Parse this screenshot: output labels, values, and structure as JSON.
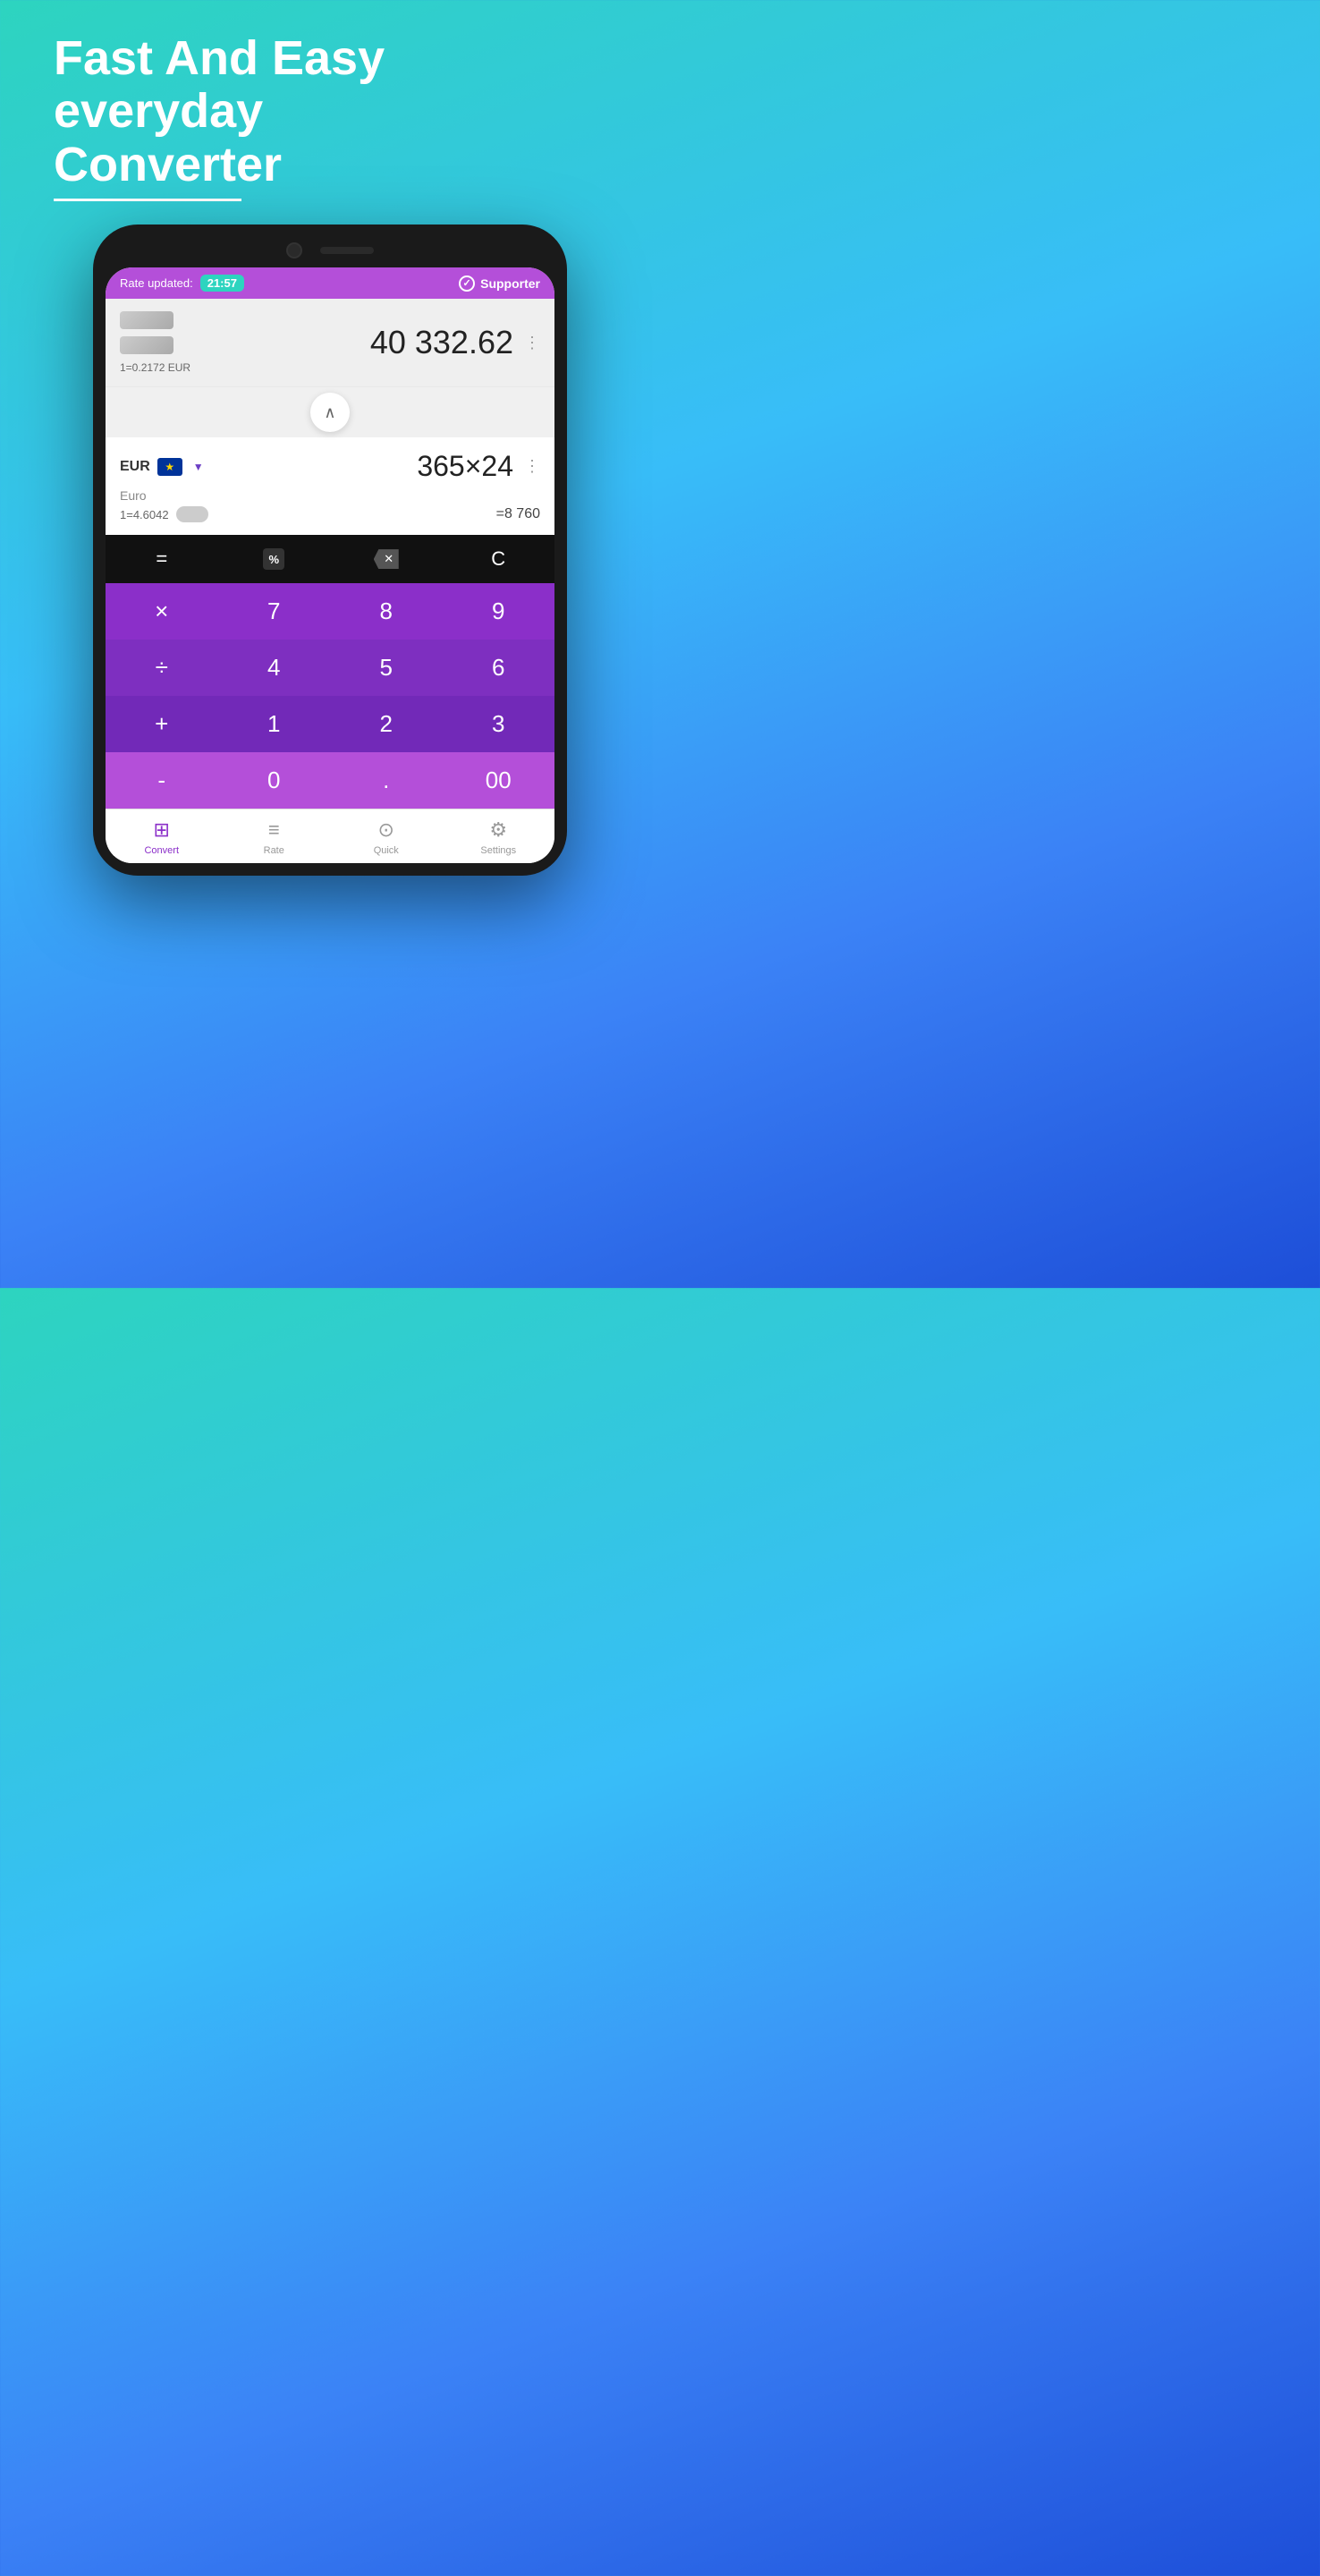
{
  "hero": {
    "line1": "Fast And Easy",
    "line2": "everyday",
    "line3": "Converter"
  },
  "statusBar": {
    "rateLabel": "Rate updated:",
    "time": "21:57",
    "supporterLabel": "Supporter"
  },
  "topCurrency": {
    "value": "40 332.62",
    "rate": "1=0.2172 EUR"
  },
  "bottomCurrency": {
    "expression": "365×24",
    "result": "=8 760",
    "code": "EUR",
    "name": "Euro",
    "rate": "1=4.6042"
  },
  "operators": {
    "equals": "=",
    "percent": "%",
    "backspace": "⌫",
    "clear": "C"
  },
  "numpad": {
    "row1": [
      "×",
      "7",
      "8",
      "9"
    ],
    "row2": [
      "÷",
      "4",
      "5",
      "6"
    ],
    "row3": [
      "+",
      "1",
      "2",
      "3"
    ],
    "row4": [
      "-",
      "0",
      ".",
      "00"
    ]
  },
  "nav": {
    "items": [
      {
        "label": "Convert",
        "active": true
      },
      {
        "label": "Rate",
        "active": false
      },
      {
        "label": "Quick",
        "active": false
      },
      {
        "label": "Settings",
        "active": false
      }
    ]
  }
}
